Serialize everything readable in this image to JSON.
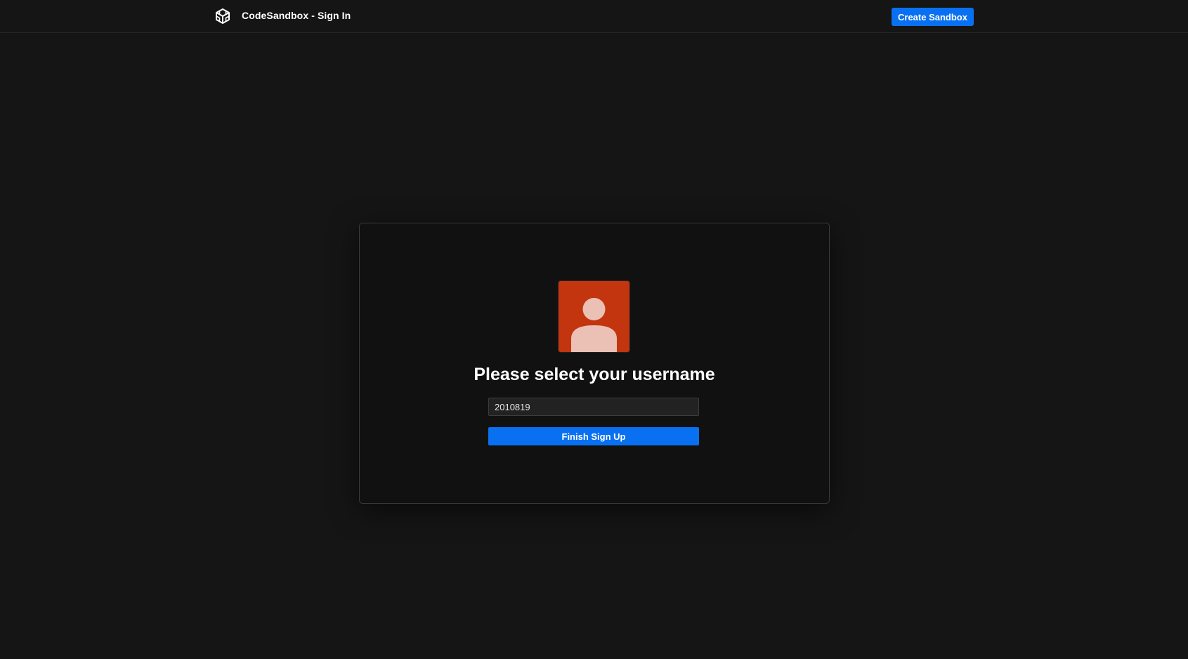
{
  "header": {
    "logo_icon": "codesandbox-cube-icon",
    "title": "CodeSandbox - Sign In",
    "create_button_label": "Create Sandbox"
  },
  "signup": {
    "avatar_icon": "user-silhouette-icon",
    "heading": "Please select your username",
    "username_value": "2010819",
    "submit_label": "Finish Sign Up"
  },
  "colors": {
    "background": "#151515",
    "card_background": "#111111",
    "accent_blue": "#0971f1",
    "avatar_background": "#c2350f",
    "avatar_figure": "#ebc0b5"
  }
}
